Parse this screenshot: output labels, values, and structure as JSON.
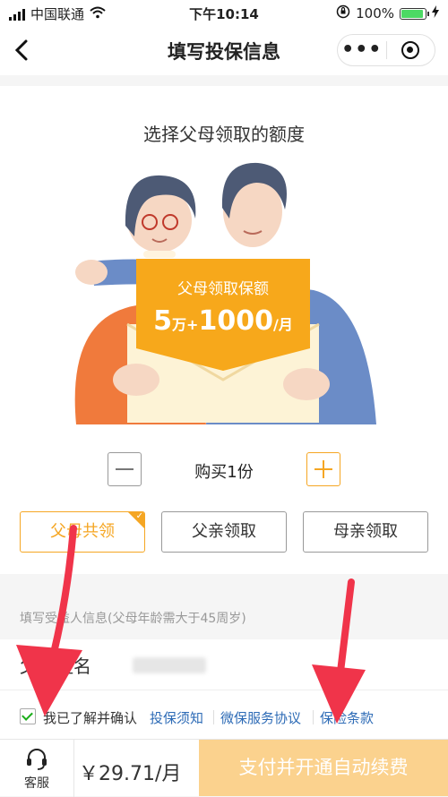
{
  "status_bar": {
    "carrier": "中国联通",
    "time": "下午10:14",
    "battery": "100%"
  },
  "nav": {
    "title": "填写投保信息",
    "more_symbol": "•••"
  },
  "card": {
    "heading": "选择父母领取的额度",
    "banner_title": "父母领取保额",
    "amount_a": "5",
    "unit_a": "万+",
    "amount_b": "1000",
    "unit_b": "/月",
    "quantity_label": "购买1份"
  },
  "options": [
    {
      "label": "父母共领",
      "selected": true
    },
    {
      "label": "父亲领取",
      "selected": false
    },
    {
      "label": "母亲领取",
      "selected": false
    }
  ],
  "info": {
    "section_label": "填写受益人信息(父母年龄需大于45周岁)",
    "name_label": "父亲姓名"
  },
  "agreement": {
    "checked": true,
    "text": "我已了解并确认",
    "links": [
      "投保须知",
      "微保服务协议",
      "保险条款"
    ]
  },
  "bottom": {
    "service_label": "客服",
    "price": "￥29.71/月",
    "pay_label": "支付并开通自动续费"
  },
  "colors": {
    "accent": "#f5a623",
    "link": "#2d6bb6",
    "arrow": "#f0344a",
    "pay_button": "#fbd28e"
  }
}
